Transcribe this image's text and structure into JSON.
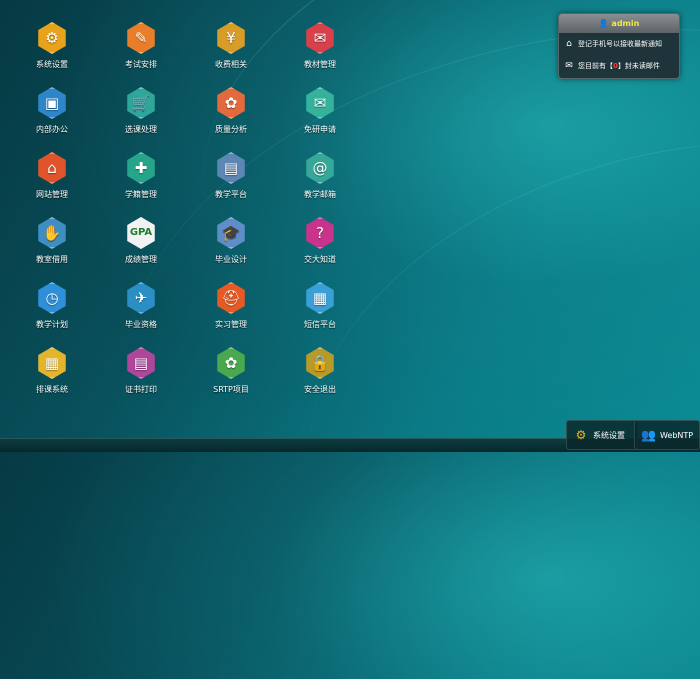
{
  "desktop": {
    "icons": [
      {
        "label": "系统设置",
        "glyph": "⚙",
        "color": "#e8a21c"
      },
      {
        "label": "考试安排",
        "glyph": "✎",
        "color": "#e87e2a"
      },
      {
        "label": "收费相关",
        "glyph": "¥",
        "color": "#d89c28"
      },
      {
        "label": "教材管理",
        "glyph": "✉",
        "color": "#d8404a"
      },
      {
        "label": "内部办公",
        "glyph": "▣",
        "color": "#2e86c8"
      },
      {
        "label": "选课处理",
        "glyph": "🛒",
        "color": "#2fa69a"
      },
      {
        "label": "质量分析",
        "glyph": "✿",
        "color": "#e26a3c"
      },
      {
        "label": "免研申请",
        "glyph": "✉",
        "color": "#34b29c"
      },
      {
        "label": "网站管理",
        "glyph": "⌂",
        "color": "#e0542c"
      },
      {
        "label": "学籍管理",
        "glyph": "✚",
        "color": "#27a58a"
      },
      {
        "label": "教学平台",
        "glyph": "▤",
        "color": "#5d86b4"
      },
      {
        "label": "教学邮箱",
        "glyph": "@",
        "color": "#36a89a"
      },
      {
        "label": "教室借用",
        "glyph": "✋",
        "color": "#3f8ec2"
      },
      {
        "label": "成绩管理",
        "glyph": "GPA",
        "color": "#f2f2f2"
      },
      {
        "label": "毕业设计",
        "glyph": "🎓",
        "color": "#5f8dc7"
      },
      {
        "label": "交大知道",
        "glyph": "?",
        "color": "#c8338c"
      },
      {
        "label": "教学计划",
        "glyph": "◷",
        "color": "#2f8fd8"
      },
      {
        "label": "毕业资格",
        "glyph": "✈",
        "color": "#2b8ec5"
      },
      {
        "label": "实习管理",
        "glyph": "⛑",
        "color": "#e85a24"
      },
      {
        "label": "短信平台",
        "glyph": "▦",
        "color": "#3a9fd6"
      },
      {
        "label": "排课系统",
        "glyph": "▦",
        "color": "#e2b52c"
      },
      {
        "label": "证书打印",
        "glyph": "▤",
        "color": "#b0459c"
      },
      {
        "label": "SRTP项目",
        "glyph": "✿",
        "color": "#4aa84e"
      },
      {
        "label": "安全退出",
        "glyph": "🔒",
        "color": "#b89a2a"
      }
    ]
  },
  "panel": {
    "user": "admin",
    "notice": "登记手机号以接收最新通知",
    "mail_prefix": "您目前有【",
    "mail_count": "0",
    "mail_suffix": "】封未读邮件"
  },
  "taskbar": {
    "settings_label": "系统设置",
    "webntp_label": "WebNTP"
  }
}
